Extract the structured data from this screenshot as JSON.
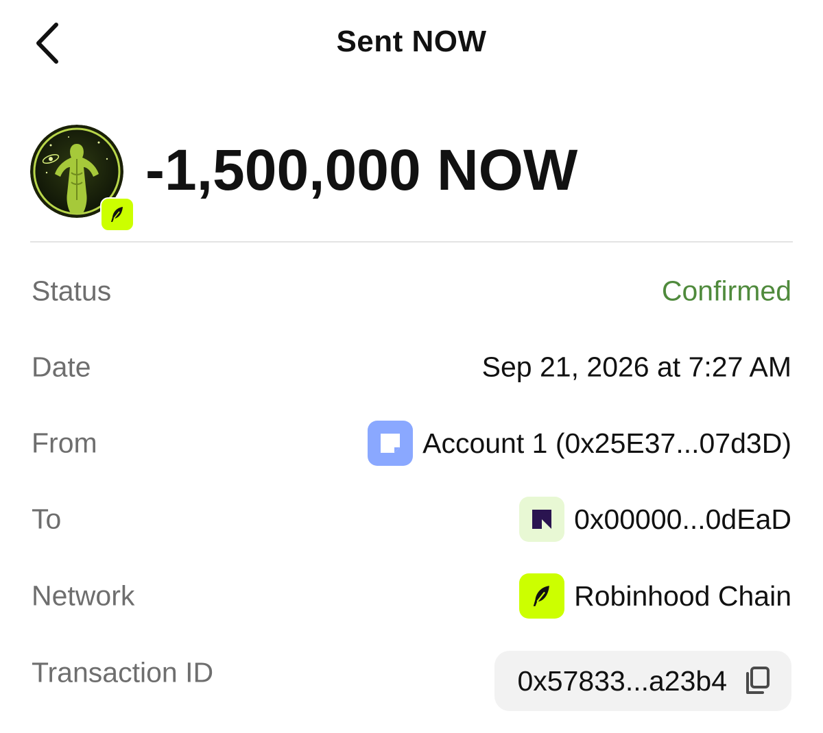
{
  "header": {
    "title": "Sent NOW",
    "back_icon": "chevron-left-icon"
  },
  "transaction": {
    "amount": "-1,500,000 NOW",
    "token_logo": "now-token-logo",
    "network_badge_icon": "feather-icon"
  },
  "details": {
    "status": {
      "label": "Status",
      "value": "Confirmed",
      "color": "#4f8a3c"
    },
    "date": {
      "label": "Date",
      "value": "Sep 21, 2026 at 7:27 AM"
    },
    "from": {
      "label": "From",
      "value": "Account 1 (0x25E37...07d3D)",
      "icon": "account-icon"
    },
    "to": {
      "label": "To",
      "value": "0x00000...0dEaD",
      "icon": "address-avatar-icon"
    },
    "network": {
      "label": "Network",
      "value": "Robinhood Chain",
      "icon": "feather-icon"
    },
    "transaction_id": {
      "label": "Transaction ID",
      "value": "0x57833...a23b4",
      "icon": "copy-icon"
    }
  },
  "colors": {
    "accent": "#ccff00",
    "status_confirmed": "#4f8a3c",
    "label_gray": "#6e6e6e"
  }
}
